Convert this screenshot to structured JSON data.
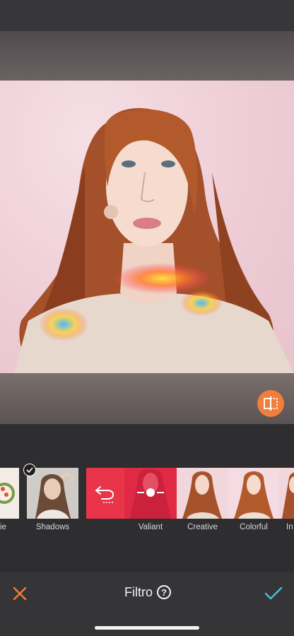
{
  "editor": {
    "filters": [
      {
        "label": "ie"
      },
      {
        "label": "Shadows"
      },
      {
        "label": "Valiant"
      },
      {
        "label": "Creative"
      },
      {
        "label": "Colorful"
      },
      {
        "label": "In"
      }
    ],
    "compare_icon": "split-compare-icon",
    "reset_icon": "undo-arrow-icon",
    "slider_icon": "intensity-slider-icon",
    "selected_icon": "checkmark-icon"
  },
  "bottom_bar": {
    "title": "Filtro",
    "help_glyph": "?",
    "cancel_icon": "close-icon",
    "confirm_icon": "check-icon"
  },
  "colors": {
    "accent_orange": "#f37d3a",
    "active_red": "#e9344a",
    "confirm_cyan": "#3ec2e6",
    "panel_dark": "#2e2e30"
  }
}
